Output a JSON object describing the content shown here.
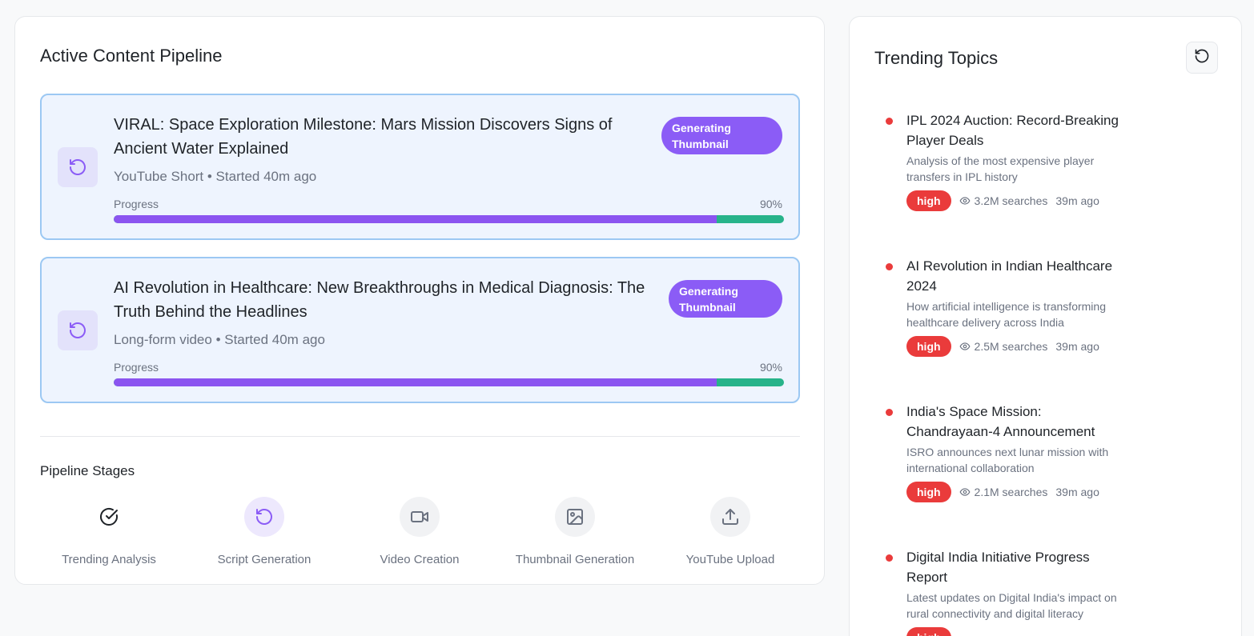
{
  "pipeline": {
    "title": "Active Content Pipeline",
    "jobs": [
      {
        "title": "VIRAL: Space Exploration Milestone: Mars Mission Discovers Signs of Ancient Water Explained",
        "meta": "YouTube Short • Started 40m ago",
        "status": "Generating Thumbnail",
        "progress_label": "Progress",
        "progress_text": "90%",
        "progress": 0.9
      },
      {
        "title": "AI Revolution in Healthcare: New Breakthroughs in Medical Diagnosis: The Truth Behind the Headlines",
        "meta": "Long-form video • Started 40m ago",
        "status": "Generating Thumbnail",
        "progress_label": "Progress",
        "progress_text": "90%",
        "progress": 0.9
      }
    ],
    "stages_title": "Pipeline Stages",
    "stages": [
      {
        "label": "Trending Analysis",
        "icon": "check-circle-icon",
        "state": "done"
      },
      {
        "label": "Script Generation",
        "icon": "refresh-icon",
        "state": "active"
      },
      {
        "label": "Video Creation",
        "icon": "video-camera-icon",
        "state": "pending"
      },
      {
        "label": "Thumbnail Generation",
        "icon": "image-icon",
        "state": "pending"
      },
      {
        "label": "YouTube Upload",
        "icon": "upload-icon",
        "state": "pending"
      }
    ]
  },
  "trending": {
    "title": "Trending Topics",
    "refresh_icon": "refresh-icon",
    "topics": [
      {
        "title": "IPL 2024 Auction: Record-Breaking Player Deals",
        "description": "Analysis of the most expensive player transfers in IPL history",
        "priority": "high",
        "searches": "3.2M searches",
        "time": "39m ago"
      },
      {
        "title": "AI Revolution in Indian Healthcare 2024",
        "description": "How artificial intelligence is transforming healthcare delivery across India",
        "priority": "high",
        "searches": "2.5M searches",
        "time": "39m ago"
      },
      {
        "title": "India's Space Mission: Chandrayaan-4 Announcement",
        "description": "ISRO announces next lunar mission with international collaboration",
        "priority": "high",
        "searches": "2.1M searches",
        "time": "39m ago"
      },
      {
        "title": "Digital India Initiative Progress Report",
        "description": "Latest updates on Digital India's impact on rural connectivity and digital literacy",
        "priority": "high",
        "searches": "",
        "time": ""
      }
    ]
  },
  "colors": {
    "accent_purple": "#8b5cf6",
    "progress_green": "#27b38a",
    "priority_red": "#ea3b3b",
    "job_background": "#eef4fe",
    "job_border": "#9cc8f3"
  }
}
